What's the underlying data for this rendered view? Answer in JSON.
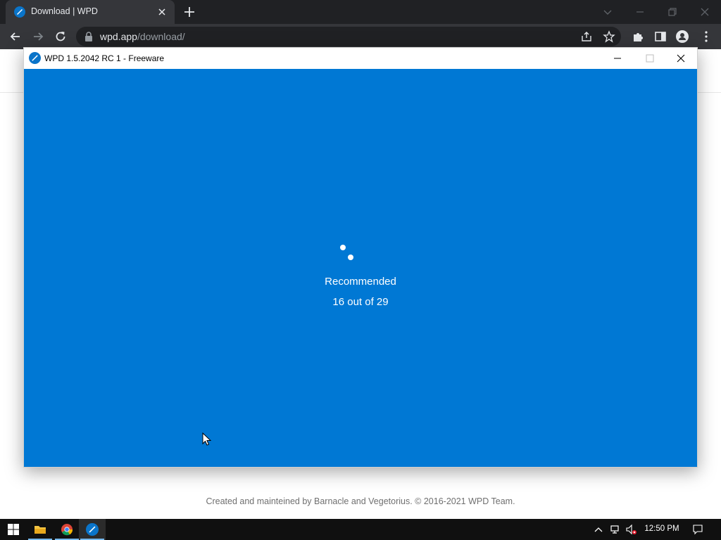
{
  "browser": {
    "tab_title": "Download | WPD",
    "url_host": "wpd.app",
    "url_path": "/download/"
  },
  "app_window": {
    "title": "WPD 1.5.2042 RC 1 - Freeware",
    "status_label": "Recommended",
    "status_count": "16 out of 29",
    "accent_color": "#0078d4"
  },
  "webpage": {
    "footer_text": "Created and mainteined by Barnacle and Vegetorius. © 2016-2021 WPD Team."
  },
  "taskbar": {
    "apps": [
      "windows-start",
      "file-explorer",
      "chrome",
      "wpd"
    ],
    "clock": "12:50 PM"
  }
}
